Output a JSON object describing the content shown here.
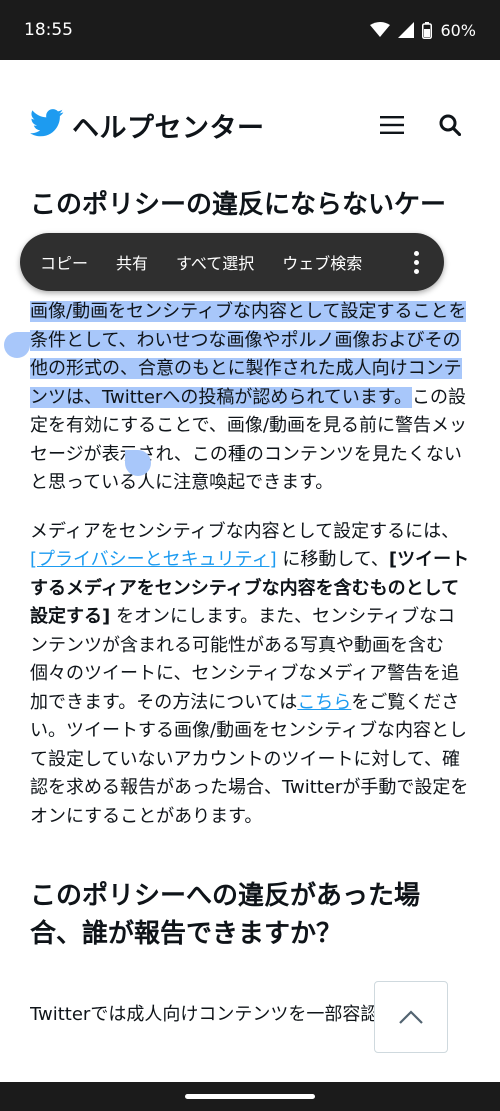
{
  "status": {
    "time": "18:55",
    "battery": "60%"
  },
  "header": {
    "title": "ヘルプセンター"
  },
  "sections": {
    "heading1": "このポリシーの違反にならないケースとは？",
    "para1_selected_part": "画像/動画をセンシティブな内容として設定することを条件として、わいせつな画像やポルノ画像およびその他の形式の、合意のもとに製作された成人向けコンテンツは、Twitterへの投稿が認められています。",
    "para1_rest": "この設定を有効にすることで、画像/動画を見る前に警告メッセージが表示され、この種のコンテンツを見たくないと思っている人に注意喚起できます。",
    "para2_a": "メディアをセンシティブな内容として設定するには、",
    "para2_link1": "[プライバシーとセキュリティ]",
    "para2_b": " に移動して、",
    "para2_bold": "[ツイートするメディアをセンシティブな内容を含むものとして設定する]",
    "para2_c": " をオンにします。また、センシティブなコンテンツが含まれる可能性がある写真や動画を含む個々のツイートに、センシティブなメディア警告を追加できます。その方法については",
    "para2_link2": "こちら",
    "para2_d": "をご覧ください。ツイートする画像/動画をセンシティブな内容として設定していないアカウントのツイートに対して、確認を求める報告があった場合、Twitterが手動で設定をオンにすることがあります。",
    "heading2": "このポリシーへの違反があった場合、誰が報告できますか？",
    "para3": "Twitterでは成人向けコンテンツを一部容認してい"
  },
  "context_menu": {
    "copy": "コピー",
    "share": "共有",
    "select_all": "すべて選択",
    "web_search": "ウェブ検索"
  },
  "colors": {
    "accent": "#1d9bf0",
    "selection": "#a8c7fa",
    "menu_bg": "#2f2f2f"
  }
}
